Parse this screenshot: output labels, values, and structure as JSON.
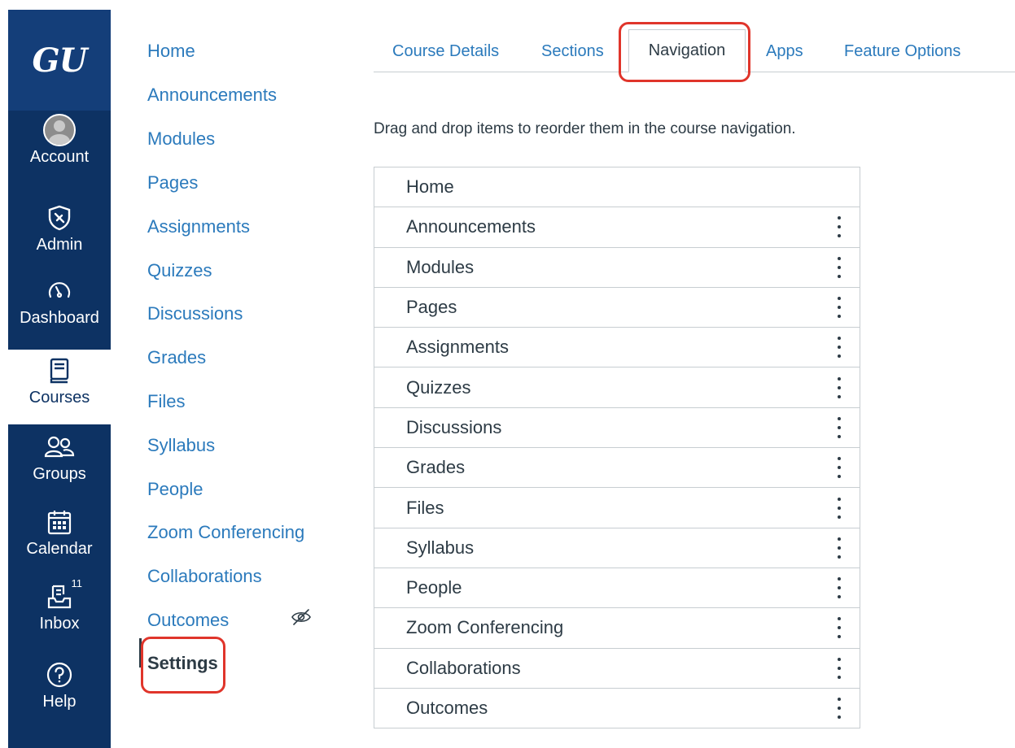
{
  "global_nav": {
    "logo": "GU",
    "items": [
      {
        "label": "Account",
        "icon": "avatar-icon"
      },
      {
        "label": "Admin",
        "icon": "shield-icon"
      },
      {
        "label": "Dashboard",
        "icon": "speedometer-icon"
      },
      {
        "label": "Courses",
        "icon": "book-icon"
      },
      {
        "label": "Groups",
        "icon": "people-icon"
      },
      {
        "label": "Calendar",
        "icon": "calendar-icon"
      },
      {
        "label": "Inbox",
        "icon": "inbox-icon",
        "badge": "11"
      },
      {
        "label": "Help",
        "icon": "help-icon"
      }
    ],
    "active": "Courses"
  },
  "course_nav": {
    "items": [
      "Home",
      "Announcements",
      "Modules",
      "Pages",
      "Assignments",
      "Quizzes",
      "Discussions",
      "Grades",
      "Files",
      "Syllabus",
      "People",
      "Zoom Conferencing",
      "Collaborations",
      "Outcomes",
      "Settings"
    ],
    "current": "Settings",
    "hidden_item": "Outcomes"
  },
  "tabs": [
    "Course Details",
    "Sections",
    "Navigation",
    "Apps",
    "Feature Options"
  ],
  "active_tab": "Navigation",
  "instructions": "Drag and drop items to reorder them in the course navigation.",
  "navigation_list": [
    "Home",
    "Announcements",
    "Modules",
    "Pages",
    "Assignments",
    "Quizzes",
    "Discussions",
    "Grades",
    "Files",
    "Syllabus",
    "People",
    "Zoom Conferencing",
    "Collaborations",
    "Outcomes"
  ],
  "colors": {
    "global_nav_bg": "#0d3263",
    "logo_bg": "#143e79",
    "link": "#2b7abc",
    "text": "#2d3b45",
    "highlight": "#e0352b"
  }
}
